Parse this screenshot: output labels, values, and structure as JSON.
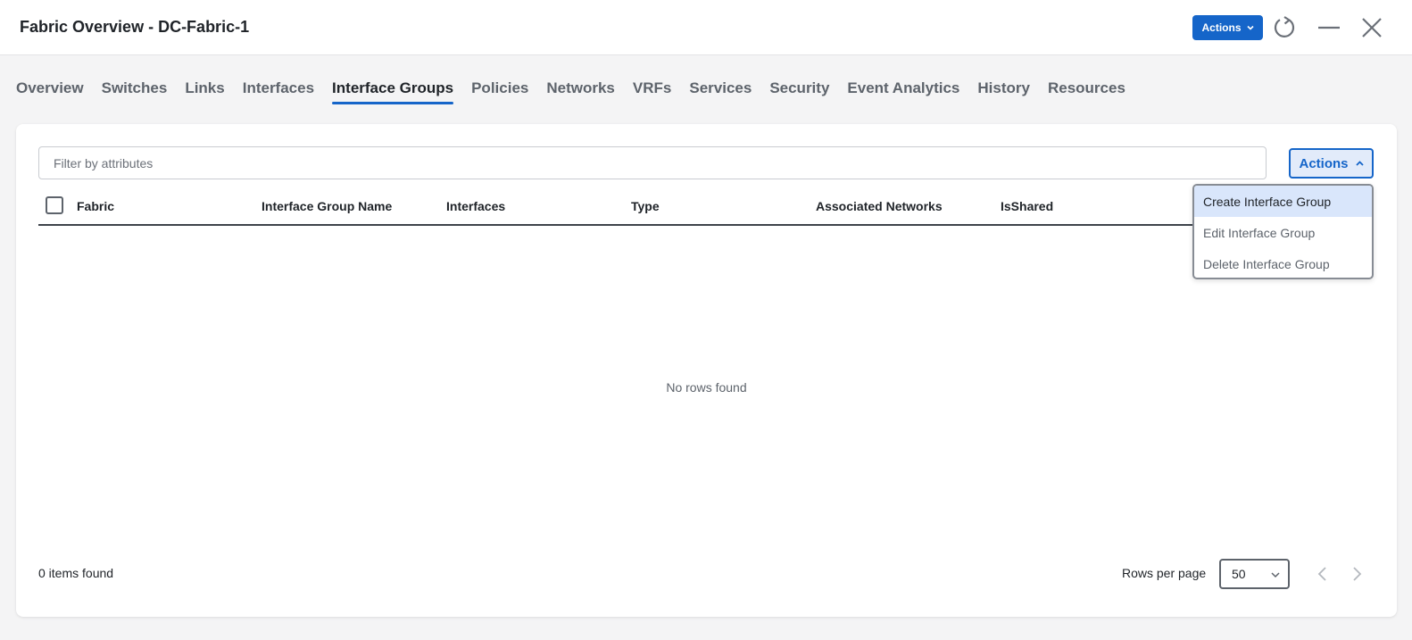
{
  "window": {
    "title": "Fabric Overview - DC-Fabric-1",
    "actions_label": "Actions",
    "icons": [
      "refresh-icon",
      "minimize-icon",
      "close-icon"
    ]
  },
  "tabs": [
    {
      "label": "Overview"
    },
    {
      "label": "Switches"
    },
    {
      "label": "Links"
    },
    {
      "label": "Interfaces"
    },
    {
      "label": "Interface Groups",
      "active": true
    },
    {
      "label": "Policies"
    },
    {
      "label": "Networks"
    },
    {
      "label": "VRFs"
    },
    {
      "label": "Services"
    },
    {
      "label": "Security"
    },
    {
      "label": "Event Analytics"
    },
    {
      "label": "History"
    },
    {
      "label": "Resources"
    }
  ],
  "toolbar": {
    "filter_placeholder": "Filter by attributes",
    "actions_label": "Actions"
  },
  "table": {
    "columns": [
      "Fabric",
      "Interface Group Name",
      "Interfaces",
      "Type",
      "Associated Networks",
      "IsShared"
    ],
    "rows": [],
    "empty_text": "No rows found"
  },
  "actions_menu": {
    "items": [
      {
        "label": "Create Interface Group",
        "highlighted": true
      },
      {
        "label": "Edit Interface Group"
      },
      {
        "label": "Delete Interface Group"
      }
    ]
  },
  "footer": {
    "items_found": "0 items found",
    "rows_per_page_label": "Rows per page",
    "rows_per_page_value": "50"
  },
  "colors": {
    "accent": "#1565c9",
    "menu_highlight": "#d9e6fb",
    "background": "#f4f4f5"
  }
}
